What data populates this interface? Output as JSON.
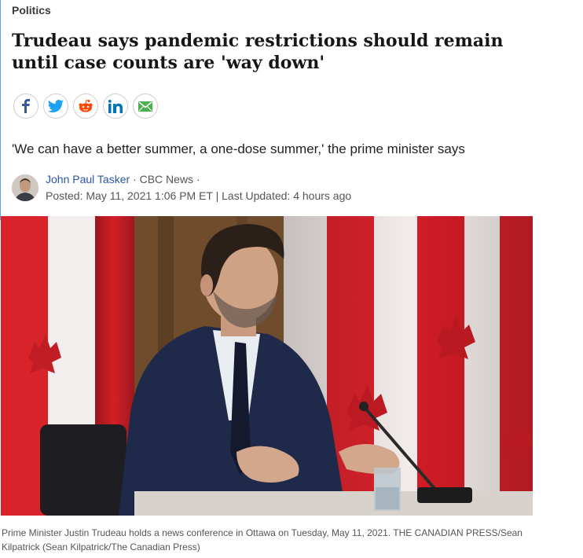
{
  "section": "Politics",
  "headline": "Trudeau says pandemic restrictions should remain until case counts are 'way down'",
  "share": [
    {
      "icon": "facebook-icon",
      "color": "#3b5998"
    },
    {
      "icon": "twitter-icon",
      "color": "#1da1f2"
    },
    {
      "icon": "reddit-icon",
      "color": "#ff4500"
    },
    {
      "icon": "linkedin-icon",
      "color": "#0077b5"
    },
    {
      "icon": "email-icon",
      "color": "#4caf50"
    }
  ],
  "deck": "'We can have a better summer, a one-dose summer,' the prime minister says",
  "byline": {
    "author": "John Paul Tasker",
    "separator1": " · ",
    "outlet": "CBC News",
    "separator2": " · ",
    "posted": "Posted: May 11, 2021 1:06 PM ET | Last Updated: 4 hours ago"
  },
  "photo": {
    "caption": "Prime Minister Justin Trudeau holds a news conference in Ottawa on Tuesday, May 11, 2021. THE CANADIAN PRESS/Sean Kilpatrick (Sean Kilpatrick/The Canadian Press)"
  }
}
